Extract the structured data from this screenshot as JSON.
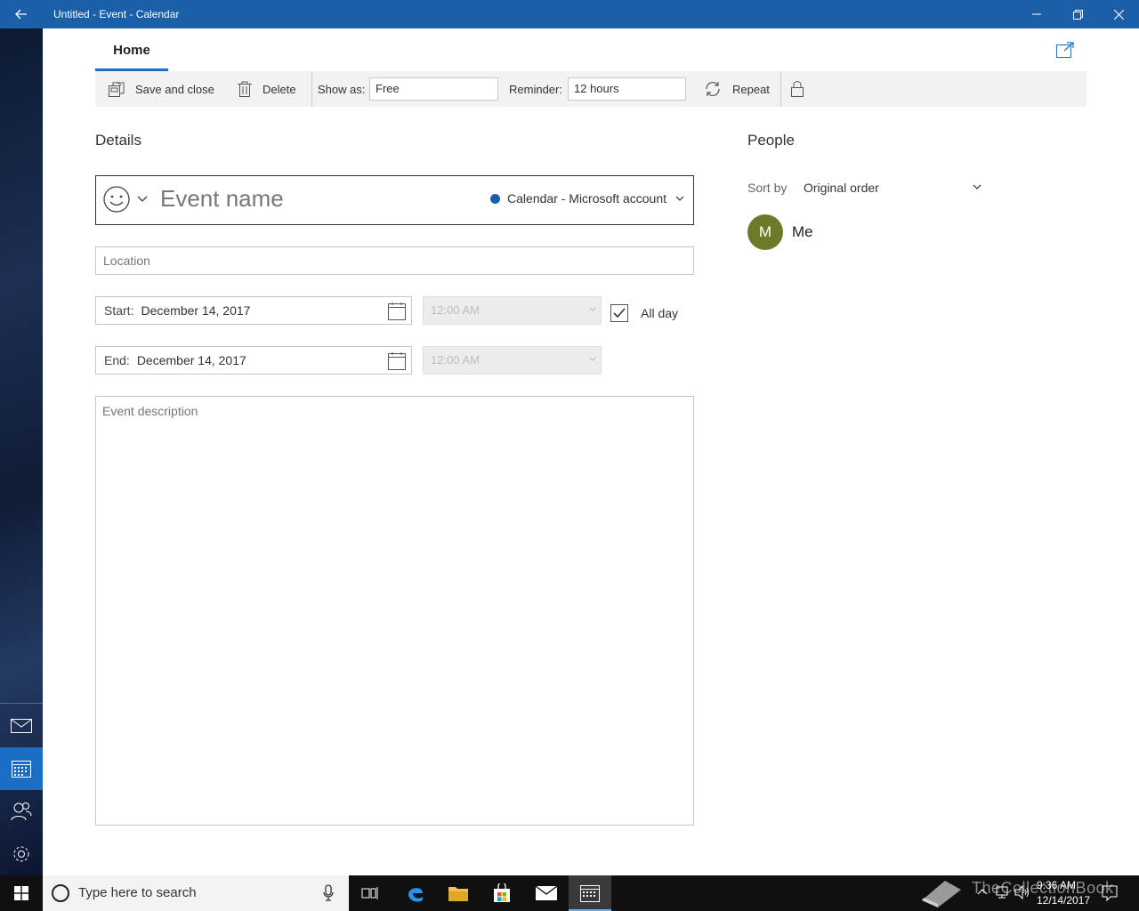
{
  "window": {
    "title": "Untitled - Event - Calendar"
  },
  "tabs": {
    "home": "Home"
  },
  "toolbar": {
    "save_label": "Save and close",
    "delete_label": "Delete",
    "show_as_label": "Show as:",
    "show_as_value": "Free",
    "reminder_label": "Reminder:",
    "reminder_value": "12 hours",
    "repeat_label": "Repeat"
  },
  "details": {
    "title": "Details",
    "event_name_placeholder": "Event name",
    "calendar_value": "Calendar - Microsoft account",
    "calendar_color": "#1a5fa8",
    "location_placeholder": "Location",
    "start_label": "Start:",
    "start_date": "December 14, 2017",
    "start_time": "12:00 AM",
    "end_label": "End:",
    "end_date": "December 14, 2017",
    "end_time": "12:00 AM",
    "all_day_label": "All day",
    "all_day_checked": true,
    "description_placeholder": "Event description"
  },
  "people": {
    "title": "People",
    "sort_label": "Sort by",
    "sort_value": "Original order",
    "attendees": [
      {
        "initial": "M",
        "name": "Me",
        "color": "#6b7b2a"
      }
    ]
  },
  "taskbar": {
    "search_placeholder": "Type here to search",
    "watermark": "TheCollectionBook",
    "clock_time": "9:36 AM",
    "clock_date": "12/14/2017"
  },
  "colors": {
    "titlebar": "#1a5fa8",
    "accent": "#1a6fc4"
  }
}
